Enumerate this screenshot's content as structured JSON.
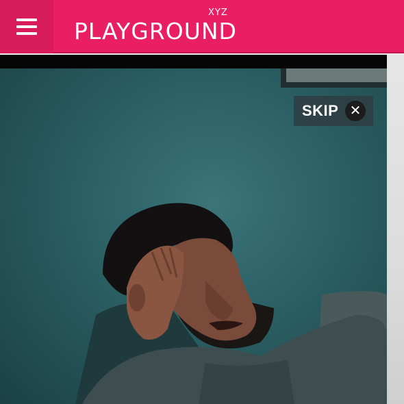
{
  "header": {
    "logo_text": "PLAYGROUND",
    "logo_superscript": "XYZ",
    "brand_color": "#e91e63",
    "menu_icon": "hamburger-menu-icon"
  },
  "ad": {
    "skip_label": "SKIP",
    "close_icon": "close-icon"
  }
}
